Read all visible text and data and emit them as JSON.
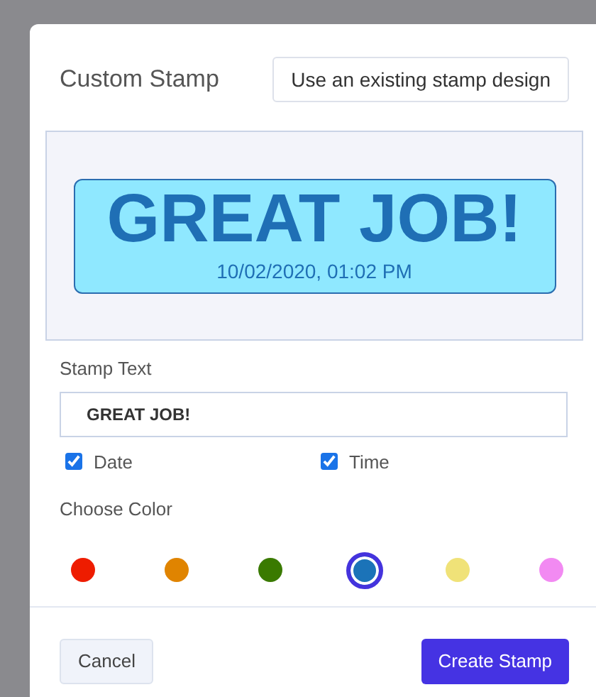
{
  "dialog": {
    "title": "Custom Stamp",
    "existing_button": "Use an existing stamp design"
  },
  "preview": {
    "text": "GREAT JOB!",
    "timestamp": "10/02/2020, 01:02 PM"
  },
  "stamp_text": {
    "label": "Stamp Text",
    "value": "GREAT JOB!"
  },
  "options": [
    {
      "label": "Date",
      "checked": true
    },
    {
      "label": "Time",
      "checked": true
    }
  ],
  "color_label": "Choose Color",
  "colors": [
    {
      "color": "#ee1c00",
      "selected": false
    },
    {
      "color": "#e08400",
      "selected": false
    },
    {
      "color": "#3a7a00",
      "selected": false
    },
    {
      "color": "#1b73b8",
      "selected": true
    },
    {
      "color": "#f0e278",
      "selected": false
    },
    {
      "color": "#f28af2",
      "selected": false
    }
  ],
  "buttons": {
    "cancel": "Cancel",
    "create": "Create Stamp"
  }
}
